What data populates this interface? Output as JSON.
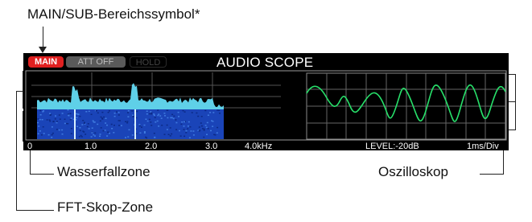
{
  "callouts": {
    "main_sub_symbol": "MAIN/SUB-Bereichssymbol*",
    "waterfall": "Wasserfallzone",
    "oscilloscope": "Oszilloskop",
    "fft": "FFT-Skop-Zone"
  },
  "scope": {
    "badges": {
      "main": "MAIN",
      "att": "ATT OFF",
      "hold": "HOLD"
    },
    "title": "AUDIO SCOPE",
    "freq_ticks": [
      "0",
      "1.0",
      "2.0",
      "3.0",
      "4.0kHz"
    ],
    "level": "LEVEL:-20dB",
    "timebase": "1ms/Div"
  },
  "colors": {
    "spectrum": "#5fd0e8",
    "waterfall": "#1a44b8",
    "wave": "#27e06a",
    "main_badge": "#e02020"
  }
}
